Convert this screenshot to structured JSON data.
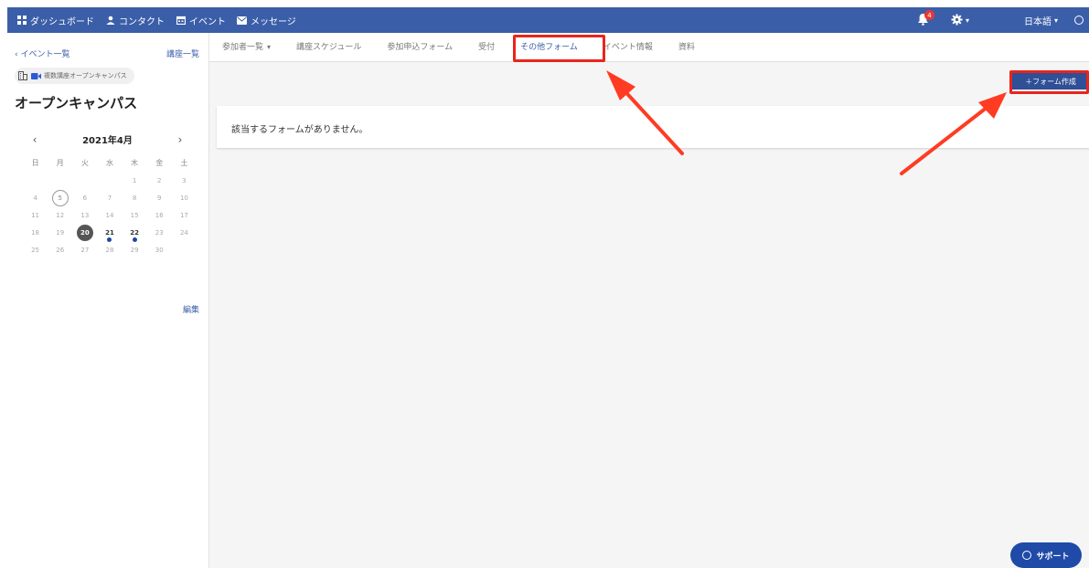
{
  "nav": {
    "items": [
      {
        "label": "ダッシュボード",
        "icon": "grid-icon"
      },
      {
        "label": "コンタクト",
        "icon": "person-icon"
      },
      {
        "label": "イベント",
        "icon": "calendar-icon"
      },
      {
        "label": "メッセージ",
        "icon": "mail-icon"
      }
    ],
    "notification_count": "4",
    "language": "日本語",
    "language_caret": "▾"
  },
  "sidebar": {
    "back_link": "‹ イベント一覧",
    "course_list_link": "講座一覧",
    "chip_label": "複数講座オープンキャンパス",
    "event_title": "オープンキャンパス",
    "calendar": {
      "month_label": "2021年4月",
      "prev": "‹",
      "next": "›",
      "weekdays": [
        "日",
        "月",
        "火",
        "水",
        "木",
        "金",
        "土"
      ],
      "leading_blanks": 4,
      "days": [
        "1",
        "2",
        "3",
        "4",
        "5",
        "6",
        "7",
        "8",
        "9",
        "10",
        "11",
        "12",
        "13",
        "14",
        "15",
        "16",
        "17",
        "18",
        "19",
        "20",
        "21",
        "22",
        "23",
        "24",
        "25",
        "26",
        "27",
        "28",
        "29",
        "30"
      ],
      "today": "5",
      "selected": "20",
      "event_days": [
        "21",
        "22"
      ]
    },
    "edit_link": "編集"
  },
  "tabs": [
    {
      "label": "参加者一覧",
      "caret": "▾",
      "active": false
    },
    {
      "label": "講座スケジュール",
      "active": false
    },
    {
      "label": "参加申込フォーム",
      "active": false
    },
    {
      "label": "受付",
      "active": false
    },
    {
      "label": "その他フォーム",
      "active": true
    },
    {
      "label": "イベント情報",
      "active": false
    },
    {
      "label": "資料",
      "active": false
    }
  ],
  "main": {
    "create_button": "＋フォーム作成",
    "empty_message": "該当するフォームがありません。"
  },
  "support_button": "サポート",
  "colors": {
    "brand": "#3b5ea8",
    "annotation": "#e8251b",
    "dot": "#1a46a8"
  }
}
